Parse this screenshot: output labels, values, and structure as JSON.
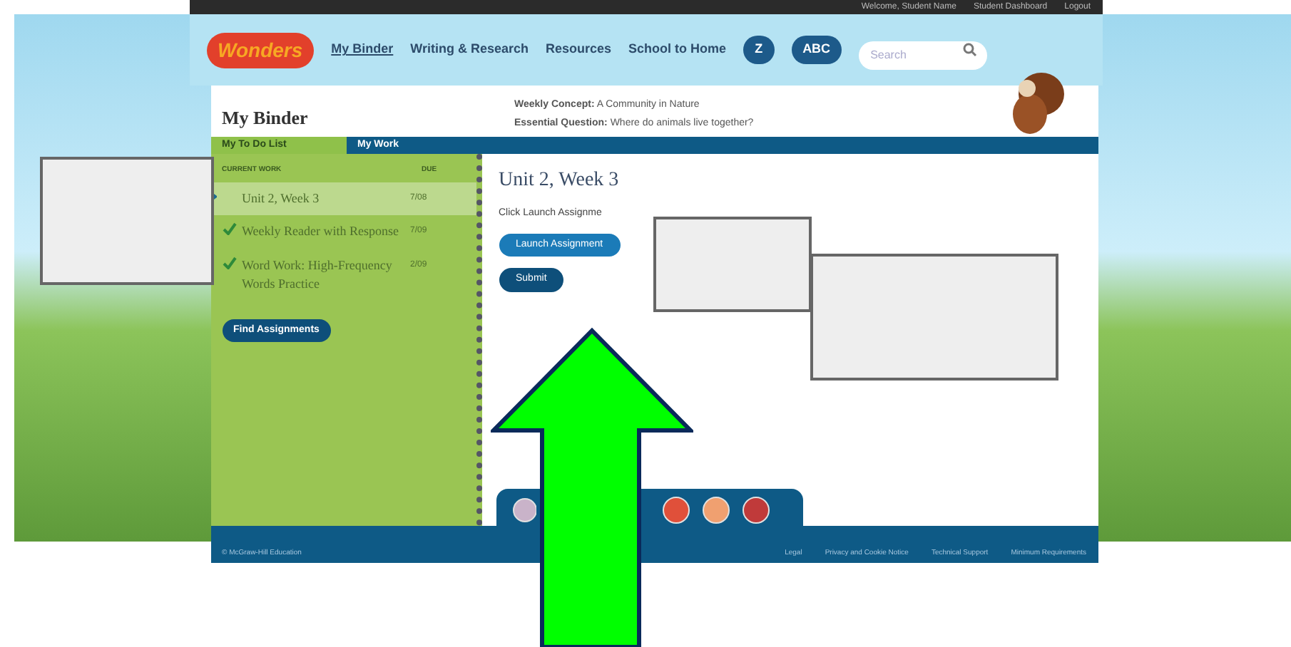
{
  "top_bar": {
    "links": [
      "Welcome, Student Name",
      "Student Dashboard",
      "Logout"
    ]
  },
  "nav": {
    "logo": "Wonders",
    "links": [
      {
        "label": "My Binder",
        "selected": true
      },
      {
        "label": "Writing & Research",
        "selected": false
      },
      {
        "label": "Resources",
        "selected": false
      },
      {
        "label": "School to Home",
        "selected": false
      }
    ],
    "pills": [
      "Z",
      "ABC"
    ],
    "search": {
      "placeholder": "Search"
    }
  },
  "binder": {
    "title": "My Binder",
    "concept_label": "Weekly Concept:",
    "concept": "A Community in Nature",
    "question_label": "Essential Question:",
    "question": "Where do animals live together?"
  },
  "tabs": [
    {
      "label": "My To Do List",
      "selected": true
    },
    {
      "label": "My Work",
      "selected": false
    }
  ],
  "todo": {
    "columns": [
      "CURRENT WORK",
      "DUE"
    ],
    "rows": [
      {
        "title": "Unit 2, Week 3",
        "due": "7/08",
        "selected": true,
        "done": false
      },
      {
        "title": "Weekly Reader with Response",
        "due": "7/09",
        "selected": false,
        "done": true
      },
      {
        "title": "Word Work: High-Frequency Words Practice",
        "due": "2/09",
        "selected": false,
        "done": true
      }
    ],
    "find_button": "Find Assignments"
  },
  "detail": {
    "title": "Unit 2, Week 3",
    "instruction": "Click Launch Assignme",
    "launch_button": "Launch Assignment",
    "submit_button": "Submit"
  },
  "footer": {
    "copyright": "© McGraw-Hill Education",
    "links": [
      "Legal",
      "Privacy and Cookie Notice",
      "Technical Support",
      "Minimum Requirements"
    ]
  }
}
